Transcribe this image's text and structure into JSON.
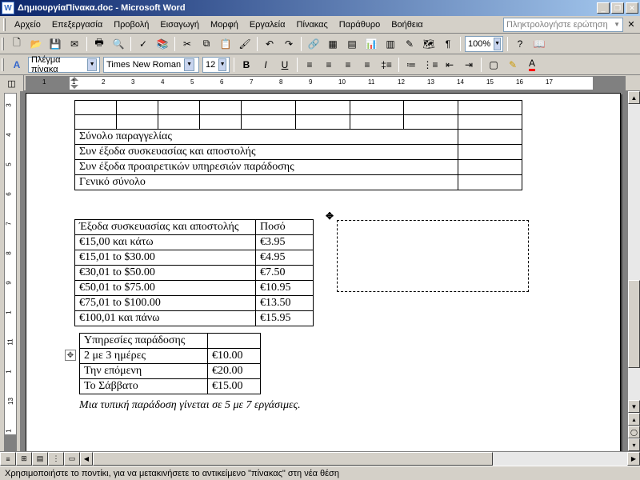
{
  "window": {
    "title": "ΔημιουργίαΠίνακα.doc - Microsoft Word",
    "app_icon_letter": "W"
  },
  "menu": {
    "items": [
      "Αρχείο",
      "Επεξεργασία",
      "Προβολή",
      "Εισαγωγή",
      "Μορφή",
      "Εργαλεία",
      "Πίνακας",
      "Παράθυρο",
      "Βοήθεια"
    ],
    "help_placeholder": "Πληκτρολογήστε ερώτηση"
  },
  "toolbar": {
    "zoom_value": "100%",
    "style_value": "Πλέγμα πίνακα",
    "font_value": "Times New Roman",
    "size_value": "12"
  },
  "ruler": {
    "h_numbers": [
      "1",
      "1",
      "2",
      "3",
      "4",
      "5",
      "6",
      "7",
      "8",
      "9",
      "10",
      "11",
      "12",
      "13",
      "14",
      "15",
      "16",
      "17"
    ],
    "v_numbers": [
      "3",
      "4",
      "5",
      "6",
      "7",
      "8",
      "9",
      "1",
      "11",
      "1",
      "13",
      "1"
    ]
  },
  "doc": {
    "table1_rows": [
      "Σύνολο παραγγελίας",
      "Συν έξοδα συσκευασίας και αποστολής",
      "Συν έξοδα προαιρετικών υπηρεσιών παράδοσης",
      "Γενικό σύνολο"
    ],
    "table2_header": [
      "Έξοδα συσκευασίας και αποστολής",
      "Ποσό"
    ],
    "table2_rows": [
      [
        "€15,00 και κάτω",
        "€3.95"
      ],
      [
        "€15,01 to $30.00",
        "€4.95"
      ],
      [
        "€30,01 to $50.00",
        "€7.50"
      ],
      [
        "€50,01 to $75.00",
        "€10.95"
      ],
      [
        "€75,01 to $100.00",
        "€13.50"
      ],
      [
        "€100,01 και πάνω",
        "€15.95"
      ]
    ],
    "table3_header": [
      "Υπηρεσίες παράδοσης",
      ""
    ],
    "table3_rows": [
      [
        "2 με 3 ημέρες",
        "€10.00"
      ],
      [
        "Την επόμενη",
        "€20.00"
      ],
      [
        "Το Σάββατο",
        "€15.00"
      ]
    ],
    "footnote": "Μια τυπική παράδοση γίνεται σε 5 με 7 εργάσιμες."
  },
  "status": {
    "text": "Χρησιμοποιήστε το ποντίκι, για να μετακινήσετε το αντικείμενο \"πίνακας\" στη νέα θέση"
  }
}
